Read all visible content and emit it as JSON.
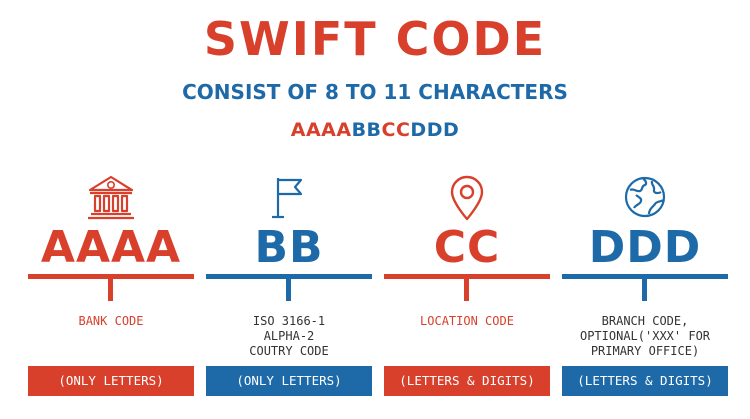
{
  "title": "SWIFT CODE",
  "subtitle": "CONSIST OF 8 TO 11 CHARACTERS",
  "format": {
    "part1": "AAAA",
    "part2": "BB",
    "part3": "CC",
    "part4": "DDD"
  },
  "columns": [
    {
      "code": "AAAA",
      "description": "BANK CODE",
      "rule": "(ONLY LETTERS)",
      "icon": "bank-icon",
      "color": "#d8402c"
    },
    {
      "code": "BB",
      "description": "ISO 3166-1\nALPHA-2\nCOUTRY CODE",
      "rule": "(ONLY LETTERS)",
      "icon": "flag-icon",
      "color": "#1e6aa8"
    },
    {
      "code": "CC",
      "description": "LOCATION CODE",
      "rule": "(LETTERS & DIGITS)",
      "icon": "location-pin-icon",
      "color": "#d8402c"
    },
    {
      "code": "DDD",
      "description": "BRANCH CODE,\nOPTIONAL('XXX' FOR\nPRIMARY OFFICE)",
      "rule": "(LETTERS & DIGITS)",
      "icon": "globe-icon",
      "color": "#1e6aa8"
    }
  ]
}
